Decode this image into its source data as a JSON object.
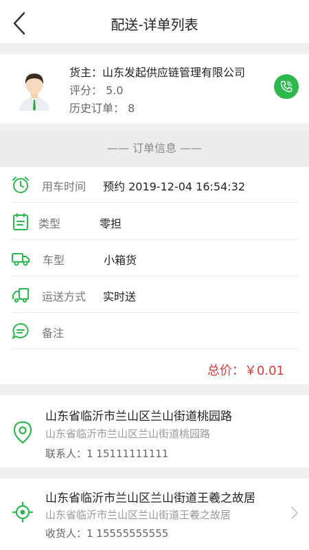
{
  "header": {
    "title": "配送-详单列表"
  },
  "shipper": {
    "owner": "货主：山东发起供应链管理有限公司",
    "rating": "评分： 5.0",
    "history": "历史订单： 8"
  },
  "order": {
    "section_title": "—— 订单信息 ——",
    "rows": [
      {
        "icon": "alarm-clock-icon",
        "label": "用车时间",
        "value": "预约 2019-12-04 16:54:32"
      },
      {
        "icon": "clipboard-icon",
        "label": "类型",
        "value": "零担"
      },
      {
        "icon": "truck-icon",
        "label": "车型",
        "value": "小箱货"
      },
      {
        "icon": "delivery-truck-icon",
        "label": "运送方式",
        "value": "实时送"
      },
      {
        "icon": "chat-bubble-icon",
        "label": "备注",
        "value": ""
      }
    ],
    "total": "总价：￥0.01"
  },
  "pickup": {
    "icon": "location-pin-icon",
    "address": "山东省临沂市兰山区兰山街道桃园路",
    "detail": "山东省临沂市兰山区兰山街道桃园路",
    "contact": "联系人：1    15111111111"
  },
  "dropoff": {
    "icon": "target-icon",
    "address": "山东省临沂市兰山区兰山街道王羲之故居",
    "detail": "山东省临沂市兰山区兰山街道王羲之故居",
    "contact": "收货人：1    15555555555"
  },
  "colors": {
    "accent": "#2db84d",
    "price": "#d93a3a"
  }
}
